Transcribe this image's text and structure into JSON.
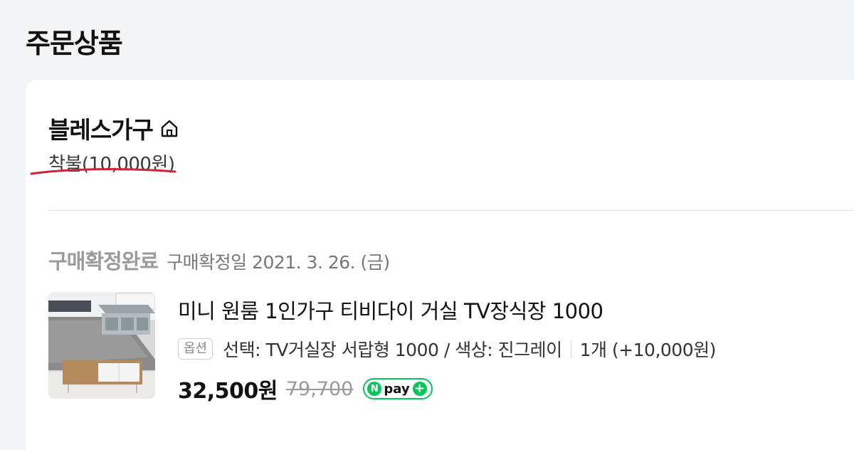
{
  "page": {
    "title": "주문상품"
  },
  "store": {
    "name": "블레스가구",
    "home_icon": "home-icon",
    "shipping": "착불(10,000원)"
  },
  "order": {
    "status": "구매확정완료",
    "status_date": "구매확정일 2021. 3. 26. (금)"
  },
  "product": {
    "title": "미니 원룸 1인가구 티비다이 거실 TV장식장 1000",
    "option_badge": "옵션",
    "option_text": "선택: TV거실장 서랍형 1000 / 색상: 진그레이",
    "quantity": "1개 (+10,000원)",
    "price": "32,500원",
    "original_price": "79,700",
    "npay_n": "N",
    "npay_label": "pay",
    "npay_plus": "+"
  },
  "colors": {
    "npay_green": "#03c75a",
    "annotation_red": "#d0243a"
  }
}
